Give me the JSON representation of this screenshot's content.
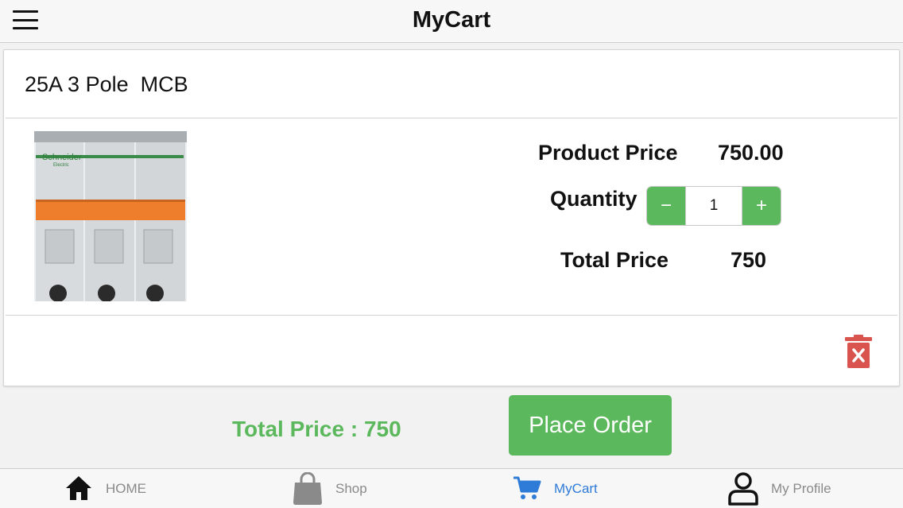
{
  "header": {
    "title": "MyCart"
  },
  "cart_item": {
    "name": "25A 3 Pole  MCB",
    "product_price_label": "Product Price",
    "product_price": "750.00",
    "quantity_label": "Quantity",
    "quantity": "1",
    "decrement_label": "−",
    "increment_label": "+",
    "total_price_label": "Total Price",
    "total_price": "750",
    "image": {
      "brand": "Schneider",
      "brand_sub": "Electric"
    }
  },
  "footer": {
    "total_text": "Total Price : 750",
    "place_order_label": "Place Order"
  },
  "tabs": [
    {
      "label": "HOME",
      "icon": "home-icon"
    },
    {
      "label": "Shop",
      "icon": "shopping-bag-icon"
    },
    {
      "label": "MyCart",
      "icon": "cart-icon",
      "active": true
    },
    {
      "label": "My Profile",
      "icon": "profile-icon"
    }
  ],
  "colors": {
    "accent_green": "#5cb85c",
    "active_tab_blue": "#2f7bd8",
    "delete_red": "#d9534f",
    "inactive_tab_gray": "#8a8a8a"
  }
}
